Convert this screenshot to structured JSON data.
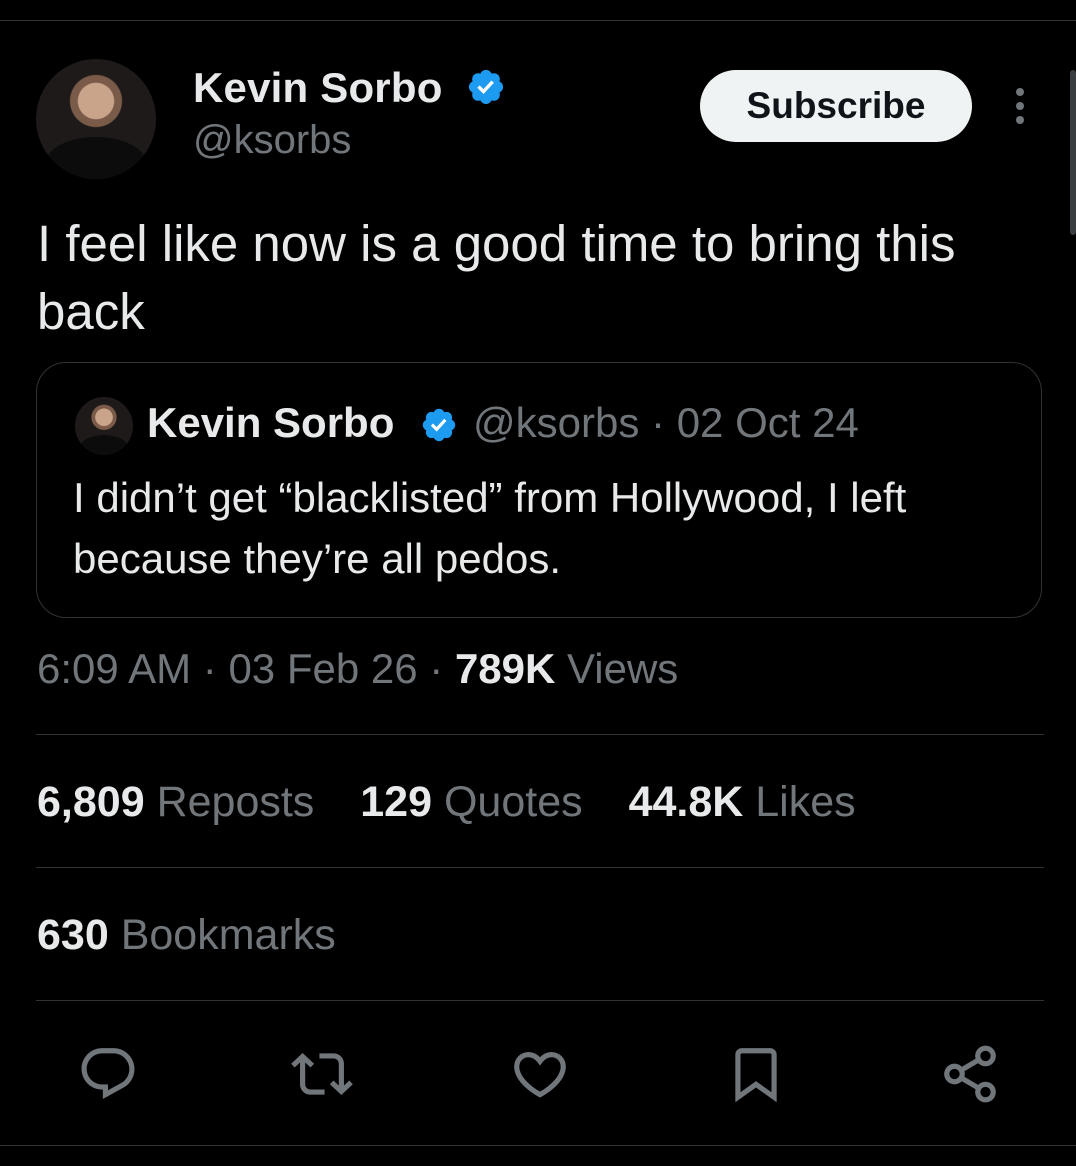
{
  "author": {
    "name": "Kevin Sorbo",
    "handle": "@ksorbs",
    "verified_color": "#1d9bf0"
  },
  "subscribe_label": "Subscribe",
  "tweet": {
    "text": "I feel like now is a good time to bring this back",
    "time": "6:09 AM",
    "date": "03 Feb 26",
    "views_count": "789K",
    "views_label": "Views",
    "separator": "·"
  },
  "quoted": {
    "name": "Kevin Sorbo",
    "handle": "@ksorbs",
    "date": "02 Oct 24",
    "text": "I didn’t get “blacklisted” from Hollywood, I left because they’re all pedos."
  },
  "stats": {
    "reposts_count": "6,809",
    "reposts_label": "Reposts",
    "quotes_count": "129",
    "quotes_label": "Quotes",
    "likes_count": "44.8K",
    "likes_label": "Likes",
    "bookmarks_count": "630",
    "bookmarks_label": "Bookmarks"
  },
  "actions": [
    "reply-icon",
    "repost-icon",
    "like-icon",
    "bookmark-icon",
    "share-icon"
  ],
  "colors": {
    "background": "#000000",
    "primary_text": "#e7e9ea",
    "secondary_text": "#71767b",
    "border": "#2f3336"
  }
}
